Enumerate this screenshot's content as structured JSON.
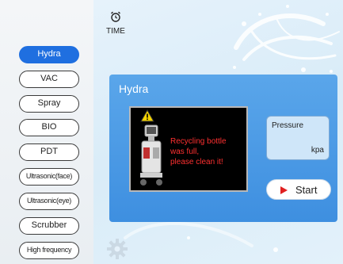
{
  "sidebar": {
    "items": [
      {
        "label": "Hydra",
        "active": true
      },
      {
        "label": "VAC",
        "active": false
      },
      {
        "label": "Spray",
        "active": false
      },
      {
        "label": "BIO",
        "active": false
      },
      {
        "label": "PDT",
        "active": false
      },
      {
        "label": "Ultrasonic(face)",
        "active": false
      },
      {
        "label": "Ultrasonic(eye)",
        "active": false
      },
      {
        "label": "Scrubber",
        "active": false
      },
      {
        "label": "High frequency",
        "active": false
      }
    ]
  },
  "header": {
    "time_label": "TIME",
    "time_icon": "alarm-clock-icon"
  },
  "panel": {
    "title": "Hydra",
    "alert": {
      "icon": "warning-icon",
      "lines": [
        "Recycling bottle",
        "was full,",
        "please clean it!"
      ]
    },
    "pressure": {
      "label": "Pressure",
      "unit": "kpa"
    },
    "start": {
      "label": "Start",
      "icon": "play-icon"
    }
  },
  "settings_icon": "gear-icon",
  "colors": {
    "accent": "#1f6fe0",
    "panel": "#4a9be5",
    "alert_text": "#ff3030",
    "start_icon": "#e02020"
  }
}
